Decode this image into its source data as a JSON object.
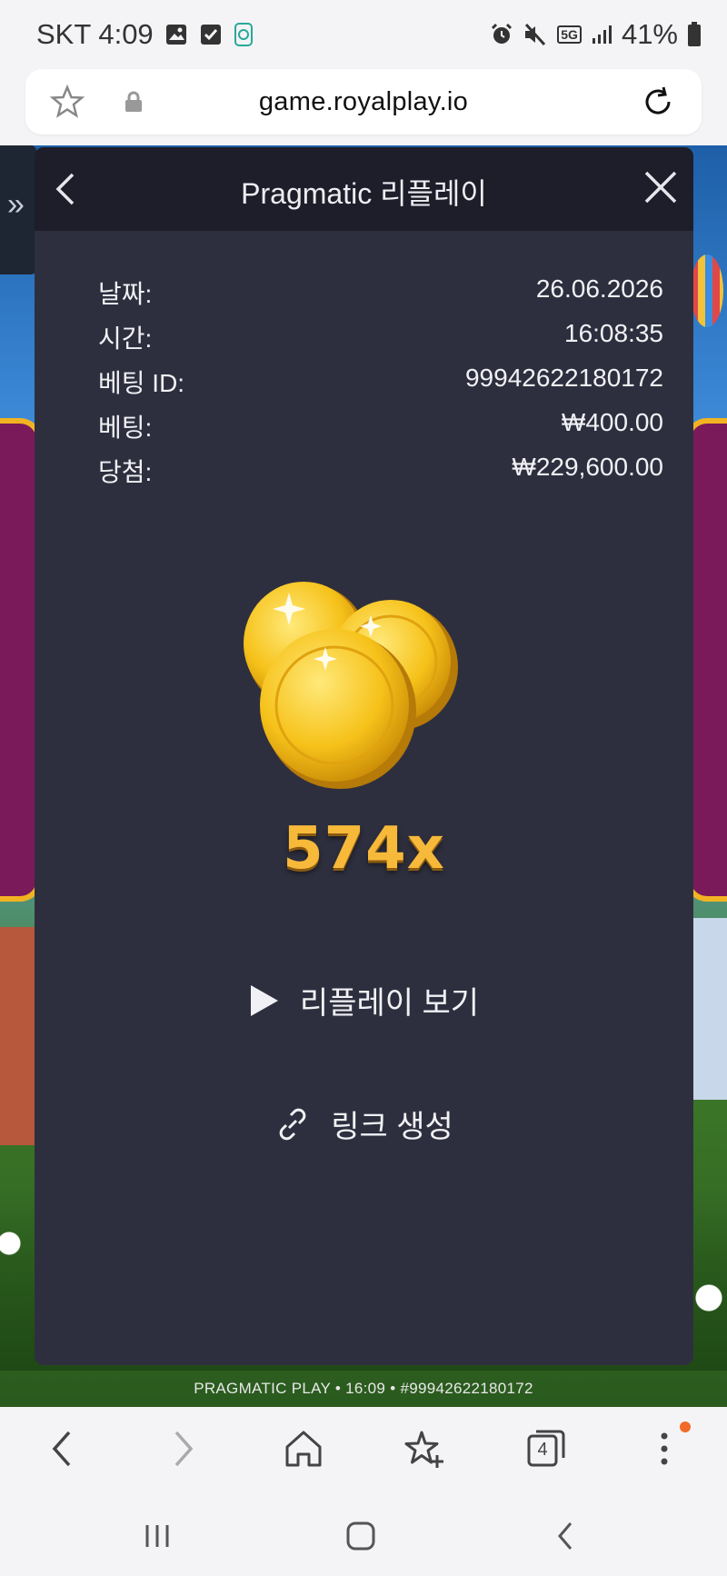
{
  "status_bar": {
    "carrier_time": "SKT 4:09",
    "battery": "41%",
    "network": "5G"
  },
  "browser": {
    "url": "game.royalplay.io",
    "tab_count": "4"
  },
  "modal": {
    "title": "Pragmatic 리플레이",
    "rows": [
      {
        "label": "날짜:",
        "value": "26.06.2026"
      },
      {
        "label": "시간:",
        "value": "16:08:35"
      },
      {
        "label": "베팅 ID:",
        "value": "99942622180172"
      },
      {
        "label": "베팅:",
        "value": "₩400.00"
      },
      {
        "label": "당첨:",
        "value": "₩229,600.00"
      }
    ],
    "multiplier": "574x",
    "replay_label": "리플레이 보기",
    "link_label": "링크 생성"
  },
  "game_footer": "PRAGMATIC PLAY • 16:09 • #99942622180172",
  "colors": {
    "modal_bg": "#2e2f3e",
    "header_bg": "#1d1e2a",
    "multiplier": "#f7b93a"
  }
}
